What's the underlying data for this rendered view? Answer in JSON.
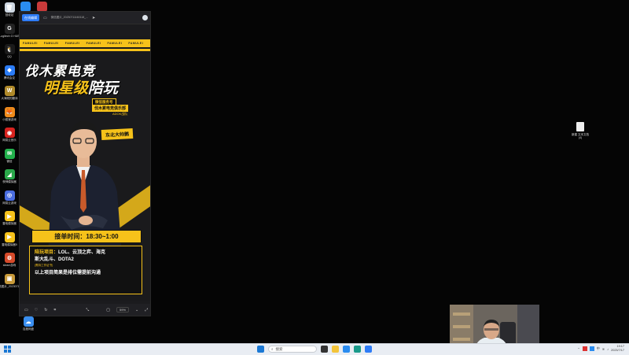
{
  "desktop": {
    "left_icons": [
      {
        "label": "回收站",
        "color": "#cfd8e3",
        "glyph": "🗑"
      },
      {
        "label": "Logitech G HUB",
        "color": "#222222",
        "glyph": "G"
      },
      {
        "label": "QQ",
        "color": "#1a1a1a",
        "glyph": "🐧"
      },
      {
        "label": "腾讯会议",
        "color": "#2b7cf6",
        "glyph": "◆"
      },
      {
        "label": "大海贼的翻译",
        "color": "#b08a2a",
        "glyph": "W"
      },
      {
        "label": "小狐狸游戏",
        "color": "#f08a1a",
        "glyph": "🦊"
      },
      {
        "label": "网易云音乐",
        "color": "#d8231f",
        "glyph": "◉"
      },
      {
        "label": "微信",
        "color": "#22b14c",
        "glyph": "✉"
      },
      {
        "label": "夜神模拟器",
        "color": "#2aa84a",
        "glyph": "◢"
      },
      {
        "label": "网易云游戏",
        "color": "#4a6de0",
        "glyph": "◎"
      },
      {
        "label": "雷电模拟器",
        "color": "#f6c21a",
        "glyph": "▶"
      },
      {
        "label": "雷电模拟器9",
        "color": "#f6c21a",
        "glyph": "▶"
      },
      {
        "label": "steam游戏",
        "color": "#d64a2a",
        "glyph": "⚙"
      },
      {
        "label": "微信图片_20230711...",
        "color": "#c89a3a",
        "glyph": "▣"
      }
    ],
    "top_icons": [
      {
        "label": "",
        "color": "#2a8cf0"
      },
      {
        "label": "",
        "color": "#c83a3a"
      }
    ],
    "extra_icon": {
      "label": "百度网盘",
      "color": "#3a8ff0",
      "glyph": "☁"
    },
    "right_file": {
      "label": "新建 文本文档 (4)"
    }
  },
  "viewer": {
    "open_button": "在线编辑",
    "file_name": "微信图片_20230711160118_...",
    "zoom": "59%"
  },
  "poster": {
    "stripe_text": "FAMULEI",
    "title_line1": "伐木累电竞",
    "title_line2_a": "明星级",
    "title_line2_b": "陪玩",
    "club_tag": "微信服务号",
    "club_name": "伐木累电竞俱乐部",
    "club_id": "ADOK战队",
    "name_tag": "东北大帅鹅",
    "time_label": "接单时间：",
    "time_value": "18:30~1:00",
    "project_key": "陪玩项目：",
    "project_value": "LOL、云顶之弈、海克",
    "project_value2": "斯大乱斗、DOTA2",
    "small_note": "(需持工作证书)",
    "footer": "以上项目简果是排位需提前沟通"
  },
  "taskbar": {
    "search_placeholder": "搜索",
    "time": "19:17",
    "date": "2023/7/17",
    "lang": "中"
  },
  "colors": {
    "accent": "#f6c21a",
    "brand": "#2e7cf6"
  }
}
